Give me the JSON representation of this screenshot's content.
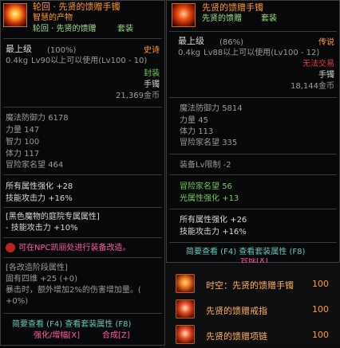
{
  "left": {
    "title": "轮回 · 先贤的馈赠手镯",
    "subtitle": "智慧的产物",
    "set_name": "轮回 · 先贤的馈赠",
    "set_tag": "套装",
    "grade": "最上级",
    "grade_pct": "(100%)",
    "rarity": "史诗",
    "weight": "0.4kg",
    "level_req": "Lv90以上可以使用(Lv100 - 10)",
    "seal": "封装",
    "slot": "手镯",
    "price": "21,369金币",
    "stats": [
      {
        "label": "魔法防御力",
        "value": "6178"
      },
      {
        "label": "力量",
        "value": "147"
      },
      {
        "label": "智力",
        "value": "100"
      },
      {
        "label": "体力",
        "value": "117"
      },
      {
        "label": "冒险家名望",
        "value": "464"
      }
    ],
    "elem_label": "所有属性强化",
    "elem_value": "+28",
    "skill_atk_label": "技能攻击力",
    "skill_atk_value": "+16%",
    "exclusive_title": "[黑色魔物的庭院专属属性]",
    "exclusive_line": "- 技能攻击力 +10%",
    "npc_note": "可在NPC凯丽处进行装备改造。",
    "reform_title": "[各改造阶段属性]",
    "reform_line1": "固有四维 +25 (+0)",
    "reform_line2": "暴击时，额外增加2%的伤害增加量。(",
    "reform_line3": "+0%)",
    "footer_line1": "简要查看 (F4) 查看套装属性 (F8)",
    "footer_line2a": "强化/增幅[X]",
    "footer_line2b": "合成[Z]"
  },
  "right": {
    "title": "先贤的馈赠手镯",
    "set_name": "先贤的馈赠",
    "set_tag": "套装",
    "grade": "最上级",
    "grade_pct": "(86%)",
    "rarity": "传说",
    "weight": "0.4kg",
    "level_req": "Lv88以上可以使用(Lv100 - 12)",
    "trade": "无法交易",
    "slot": "手镯",
    "price": "18,144金币",
    "stats": [
      {
        "label": "魔法防御力",
        "value": "5814"
      },
      {
        "label": "力量",
        "value": "45"
      },
      {
        "label": "体力",
        "value": "113"
      },
      {
        "label": "冒险家名望",
        "value": "335"
      }
    ],
    "level_limit": "装备Lv限制 -2",
    "fame_label": "冒险家名望",
    "fame_value": "56",
    "light_label": "光属性强化",
    "light_value": "+13",
    "elem_label": "所有属性强化",
    "elem_value": "+26",
    "skill_atk_label": "技能攻击力",
    "skill_atk_value": "+16%",
    "footer_line1": "简要查看 (F4) 查看套装属性 (F8)",
    "footer_line2": "合成[X]"
  },
  "list": [
    {
      "name": "时空：先贤的馈赠手镯",
      "qty": "100"
    },
    {
      "name": "先贤的馈赠戒指",
      "qty": "100"
    },
    {
      "name": "先贤的馈赠项链",
      "qty": "100"
    }
  ]
}
